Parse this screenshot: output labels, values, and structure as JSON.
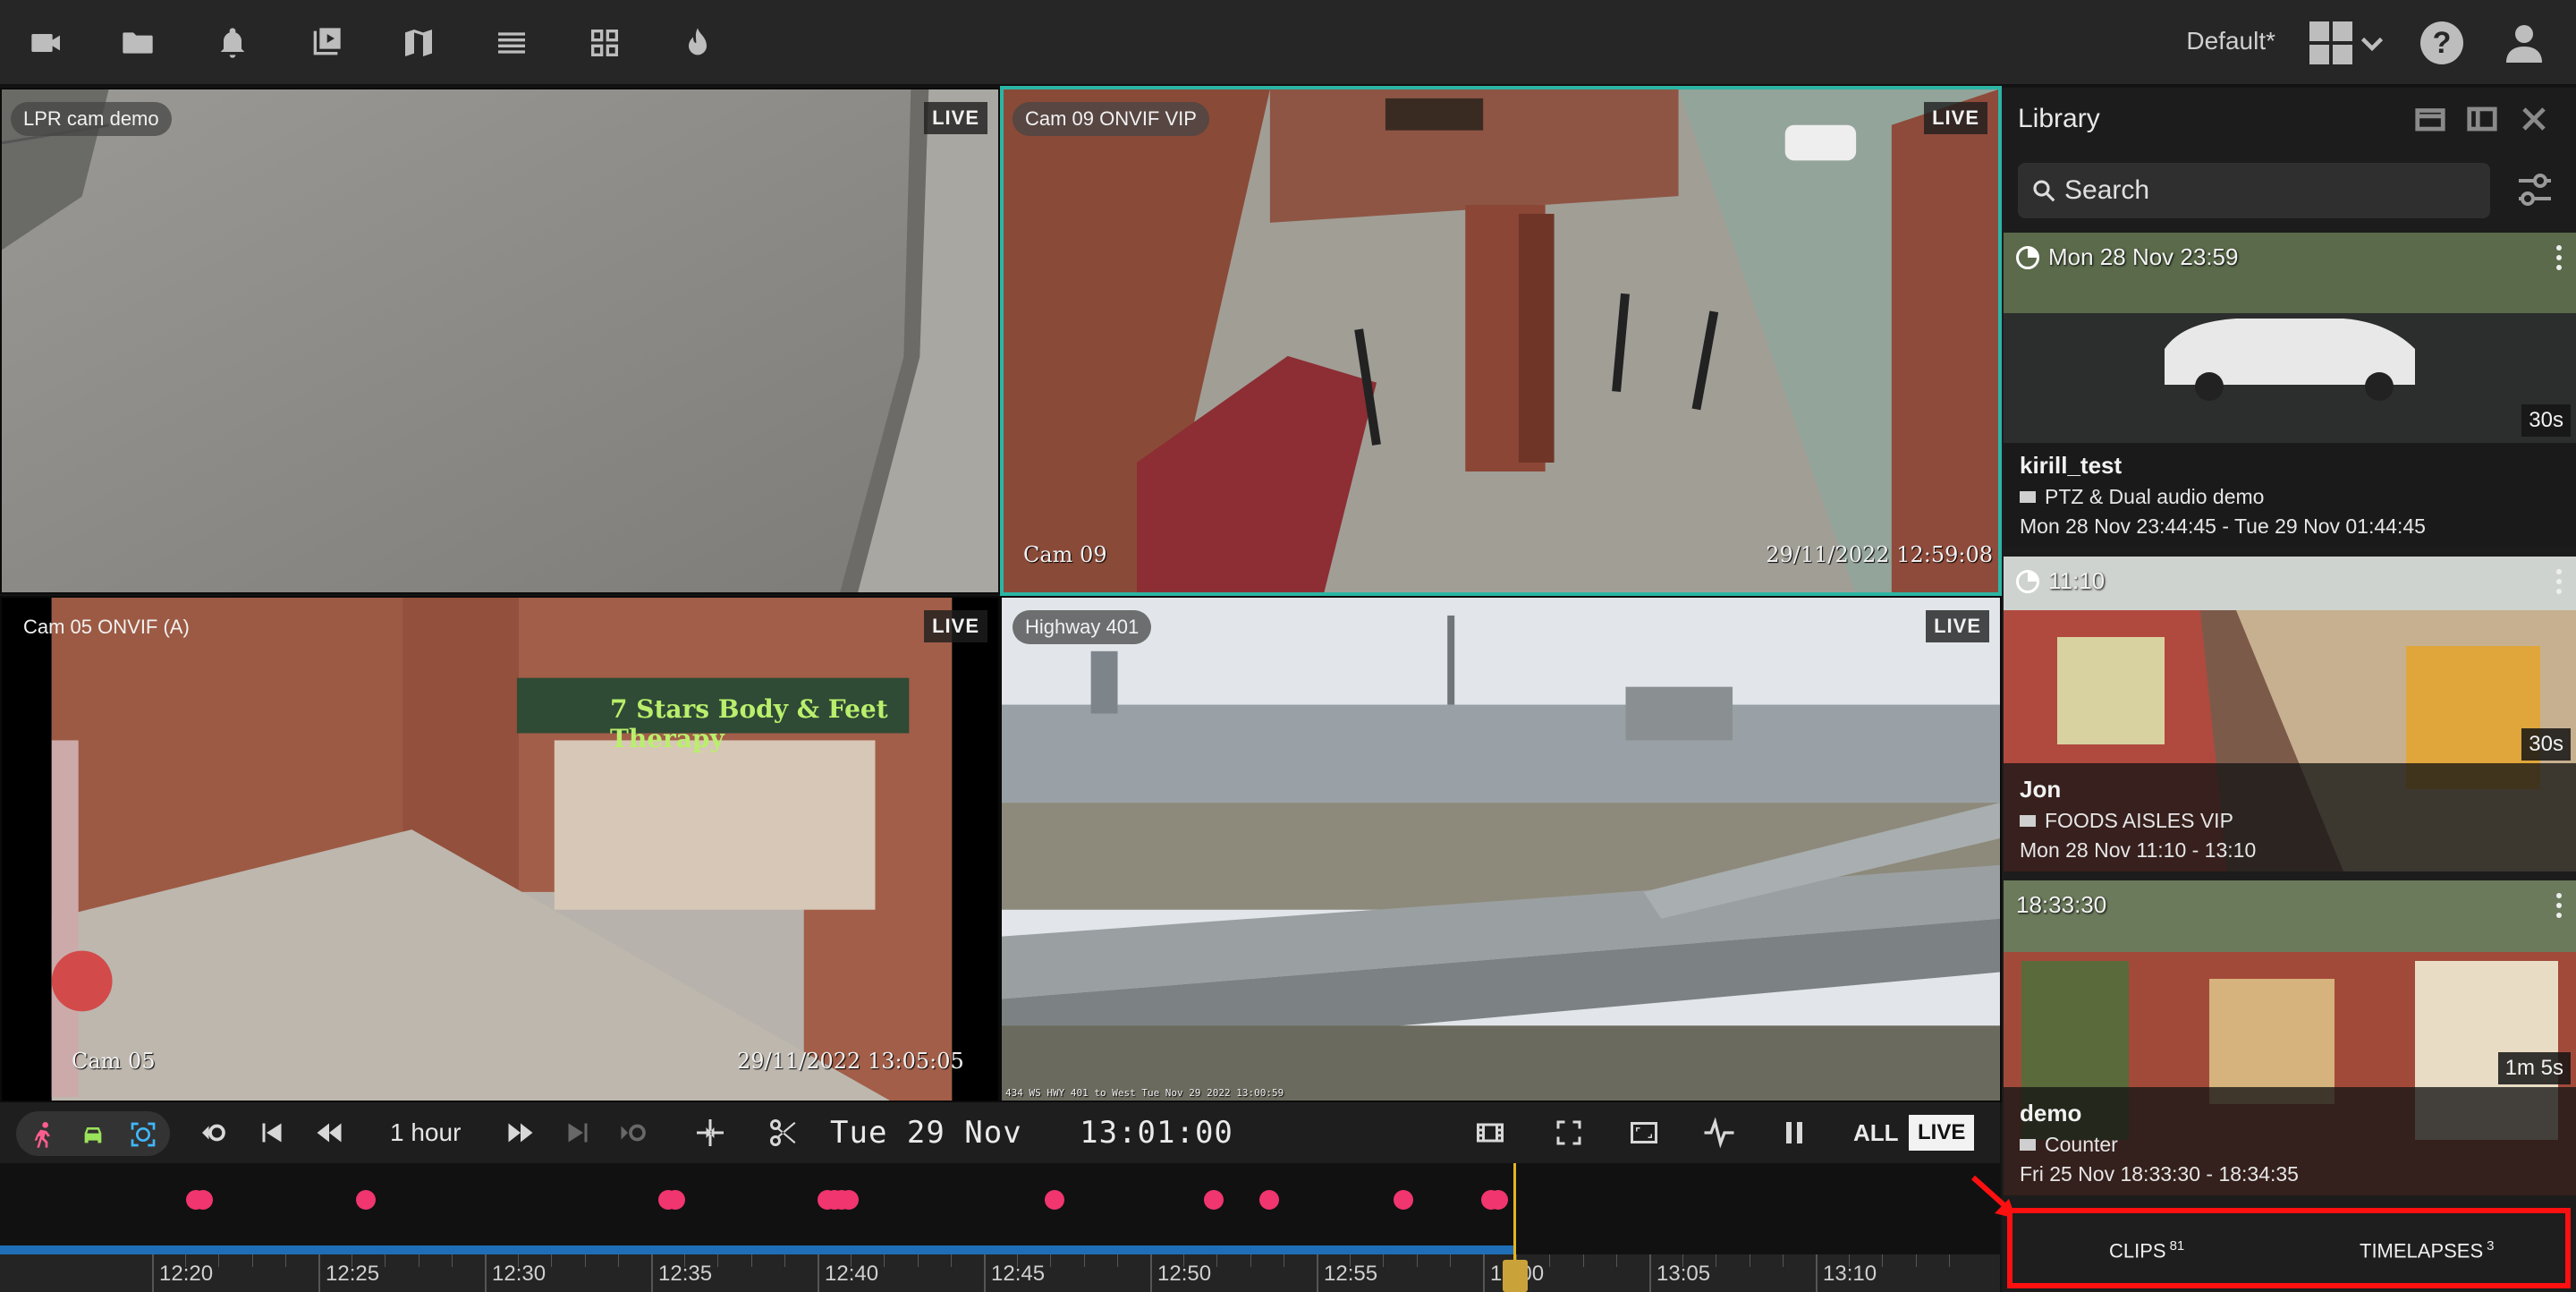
{
  "topbar": {
    "icons": [
      "camera-icon",
      "folder-icon",
      "bell-icon",
      "playlist-icon",
      "map-icon",
      "list-icon",
      "grid-icon",
      "flame-icon"
    ],
    "layout_name": "Default*",
    "help_label": "?"
  },
  "cameras": [
    {
      "label": "LPR cam demo",
      "live": "LIVE"
    },
    {
      "label": "Cam 09 ONVIF VIP",
      "live": "LIVE",
      "osd_name": "Cam 09",
      "osd_time": "29/11/2022 12:59:08"
    },
    {
      "label": "Cam 05 ONVIF (A)",
      "live": "LIVE",
      "osd_name": "Cam 05",
      "osd_time": "29/11/2022 13:05:05",
      "sign": "7 Stars Body & Feet Therapy"
    },
    {
      "label": "Highway 401",
      "live": "LIVE",
      "osd_caption": "434 WS HWY 401 to West Tue Nov 29 2022 13:00:59"
    }
  ],
  "controls": {
    "zoom_label": "1 hour",
    "date": "Tue 29 Nov",
    "time": "13:01:00",
    "all_label": "ALL",
    "live_label": "LIVE"
  },
  "timeline": {
    "ticks": [
      "12:20",
      "12:25",
      "12:30",
      "12:35",
      "12:40",
      "12:45",
      "12:50",
      "12:55",
      "13:00",
      "13:05",
      "13:10"
    ],
    "progress_fraction": 0.757
  },
  "library": {
    "title": "Library",
    "search_placeholder": "Search",
    "clips": [
      {
        "stamp": "Mon 28 Nov 23:59",
        "duration": "30s",
        "name": "kirill_test",
        "camera": "PTZ & Dual audio demo",
        "range": "Mon 28 Nov 23:44:45 - Tue 29 Nov 01:44:45"
      },
      {
        "stamp": "11:10",
        "duration": "30s",
        "name": "Jon",
        "camera": "FOODS AISLES VIP",
        "range": "Mon 28 Nov 11:10 - 13:10"
      },
      {
        "stamp": "18:33:30",
        "duration": "1m 5s",
        "name": "demo",
        "camera": "Counter",
        "range": "Fri 25 Nov 18:33:30 - 18:34:35"
      }
    ],
    "tabs": [
      {
        "label": "CLIPS",
        "count": "81"
      },
      {
        "label": "TIMELAPSES",
        "count": "3"
      }
    ]
  },
  "colors": {
    "accent": "#2bb5a5",
    "event_dot": "#f0356f",
    "progress": "#1f6fb8",
    "playhead": "#e6b420",
    "highlight": "#ff1010"
  }
}
